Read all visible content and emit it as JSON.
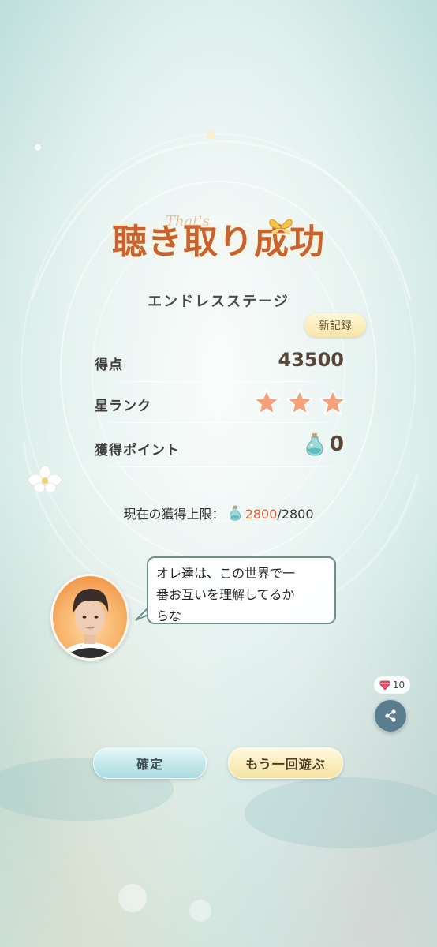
{
  "result": {
    "title": "聴き取り成功",
    "title_script": "That's",
    "stage_name": "エンドレスステージ",
    "new_record_badge": "新記録"
  },
  "stats": {
    "score_label": "得点",
    "score_value": "43500",
    "star_rank_label": "星ランク",
    "star_rank_value": 3,
    "star_rank_max": 3,
    "points_label": "獲得ポイント",
    "points_value": "0",
    "points_icon": "potion-bottle-icon"
  },
  "limit": {
    "label": "現在の獲得上限：",
    "current": "2800",
    "separator": "/",
    "max": "2800"
  },
  "dialogue": {
    "line1": "オレ達は、この世界で一",
    "line2": "番お互いを理解してるか",
    "line3": "らな"
  },
  "share": {
    "gem_count": "10",
    "gem_icon": "gem-icon",
    "share_icon": "share-icon"
  },
  "buttons": {
    "confirm_label": "確定",
    "retry_label": "もう一回遊ぶ"
  },
  "colors": {
    "title": "#c9622f",
    "limit_current": "#e0622d",
    "star": "#f4a07a",
    "share_button": "#5b7d90"
  }
}
